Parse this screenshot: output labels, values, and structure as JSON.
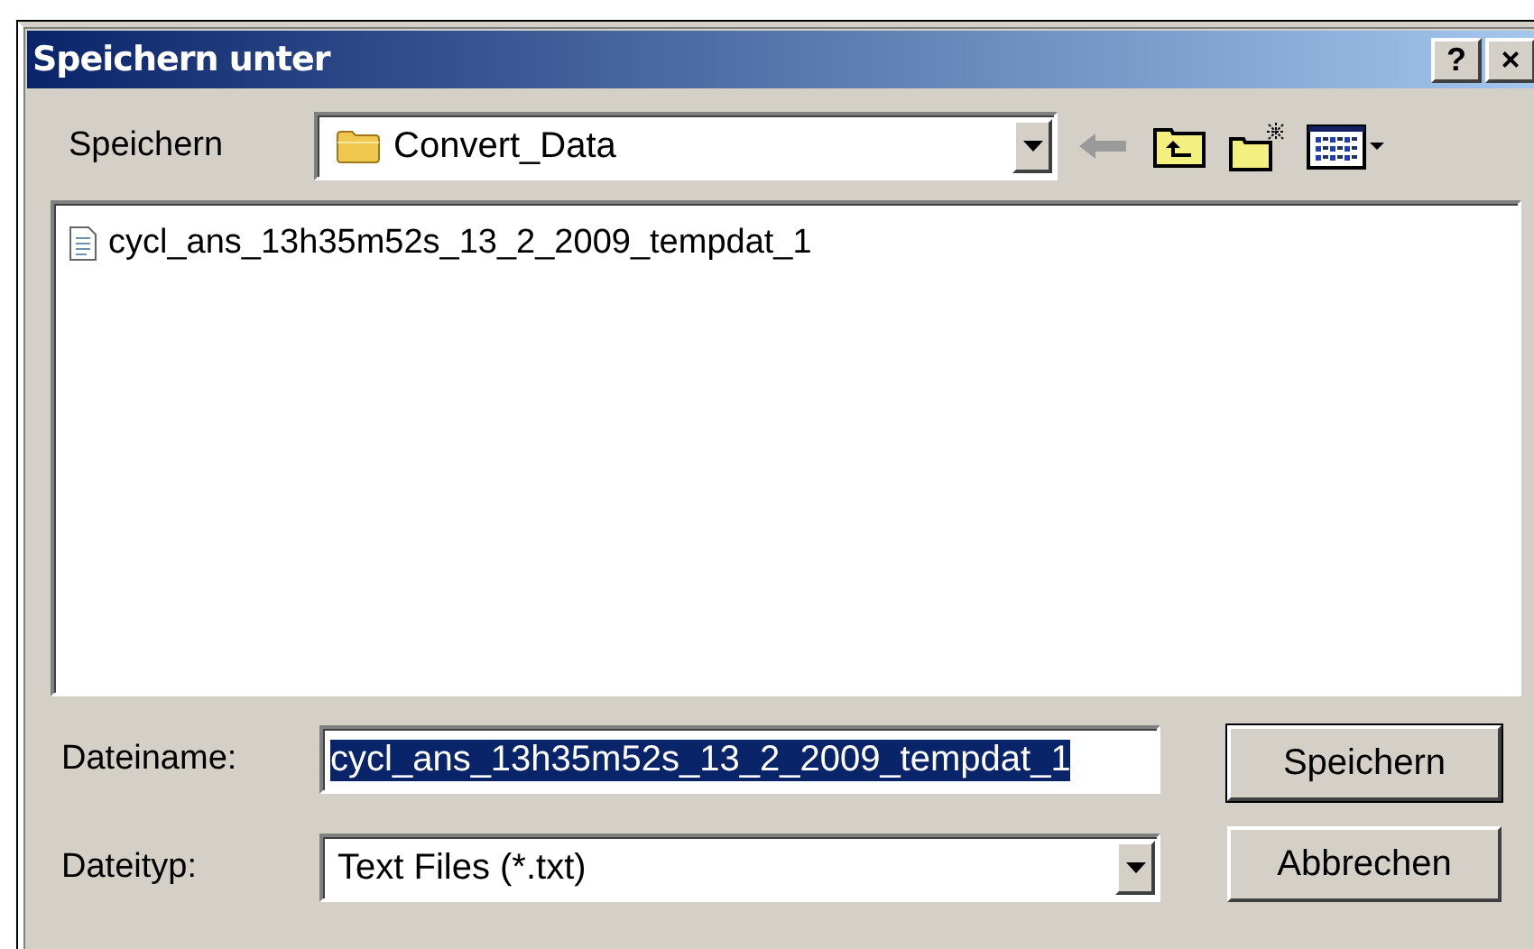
{
  "window": {
    "title": "Speichern unter",
    "title_buttons": [
      "?",
      "×"
    ]
  },
  "location": {
    "label": "Speichern",
    "value": "Convert_Data"
  },
  "files": [
    {
      "name": "cycl_ans_13h35m52s_13_2_2009_tempdat_1",
      "selected": false
    }
  ],
  "filename": {
    "label": "Dateiname:",
    "value": "cycl_ans_13h35m52s_13_2_2009_tempdat_1",
    "text_selected": true
  },
  "filetype": {
    "label": "Dateityp:",
    "value": "Text Files (*.txt)"
  },
  "buttons": [
    {
      "label": "Speichern",
      "default": true
    },
    {
      "label": "Abbrechen",
      "default": false
    }
  ]
}
